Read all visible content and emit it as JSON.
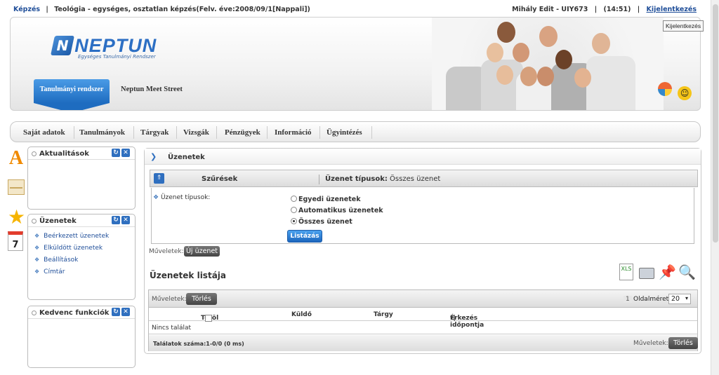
{
  "topbar": {
    "kepzes": "Képzés",
    "sep": "|",
    "course": "Teológia - egységes, osztatlan képzés(Felv. éve:2008/09/1[Nappali])",
    "user": "Mihály Edit - UIY673",
    "time": "(14:51)",
    "logout": "Kijelentkezés",
    "tooltip": "Kijelentkezés"
  },
  "header": {
    "logo": "NEPTUN",
    "logo_tag": "Egységes Tanulmányi Rendszer",
    "ribbon": "Tanulmányi rendszer",
    "meet": "Neptun Meet Street"
  },
  "nav": {
    "items": [
      "Saját adatok",
      "Tanulmányok",
      "Tárgyak",
      "Vizsgák",
      "Pénzügyek",
      "Információ",
      "Ügyintézés"
    ]
  },
  "panels": {
    "news": {
      "title": "Aktualitások"
    },
    "messages": {
      "title": "Üzenetek",
      "links": [
        "Beérkezett üzenetek",
        "Elküldött üzenetek",
        "Beállítások",
        "Címtár"
      ]
    },
    "favorites": {
      "title": "Kedvenc funkciók"
    }
  },
  "main": {
    "title": "Üzenetek",
    "filter": {
      "label": "Szűrések",
      "type_label": "Üzenet típusok:",
      "type_value": "Összes üzenet",
      "field_label": "Üzenet típusok:",
      "options": [
        "Egyedi üzenetek",
        "Automatikus üzenetek",
        "Összes üzenet"
      ],
      "selected": 2,
      "submit": "Listázás"
    },
    "ops_label": "Műveletek:",
    "new_message": "Új üzenet",
    "list_title": "Üzenetek listája",
    "table": {
      "ops_label": "Műveletek:",
      "delete": "Törlés",
      "page_num": "1",
      "page_size_label": "Oldalméret",
      "page_size": "20",
      "headers": [
        "Töröl",
        "Küldő",
        "Tárgy",
        "Érkezés időpontja"
      ],
      "empty": "Nincs találat",
      "count": "Találatok száma:1-0/0 (0 ms)",
      "foot_ops": "Műveletek:",
      "foot_delete": "Törlés"
    }
  }
}
